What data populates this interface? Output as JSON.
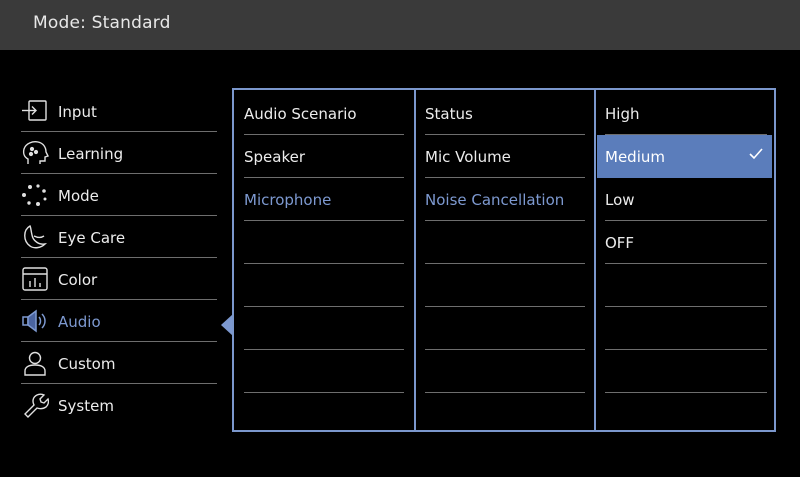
{
  "header": {
    "title": "Mode: Standard"
  },
  "sidebar": {
    "items": [
      {
        "label": "Input",
        "icon": "input-icon"
      },
      {
        "label": "Learning",
        "icon": "learning-icon"
      },
      {
        "label": "Mode",
        "icon": "mode-icon"
      },
      {
        "label": "Eye Care",
        "icon": "eye-care-icon"
      },
      {
        "label": "Color",
        "icon": "color-icon"
      },
      {
        "label": "Audio",
        "icon": "speaker-icon"
      },
      {
        "label": "Custom",
        "icon": "person-icon"
      },
      {
        "label": "System",
        "icon": "wrench-icon"
      }
    ],
    "active_item": "Audio"
  },
  "audio_menu": {
    "items": [
      "Audio Scenario",
      "Speaker",
      "Microphone"
    ],
    "selected": "Microphone"
  },
  "microphone_menu": {
    "items": [
      "Status",
      "Mic Volume",
      "Noise Cancellation"
    ],
    "selected": "Noise Cancellation"
  },
  "noise_cancellation_menu": {
    "options": [
      "High",
      "Medium",
      "Low",
      "OFF"
    ],
    "current": "Medium",
    "check_icon": "checkmark-icon"
  },
  "colors": {
    "accent": "#7d99d0",
    "highlight": "#5b7dbb",
    "header_bg": "#3a3a3a",
    "background": "#000000"
  }
}
